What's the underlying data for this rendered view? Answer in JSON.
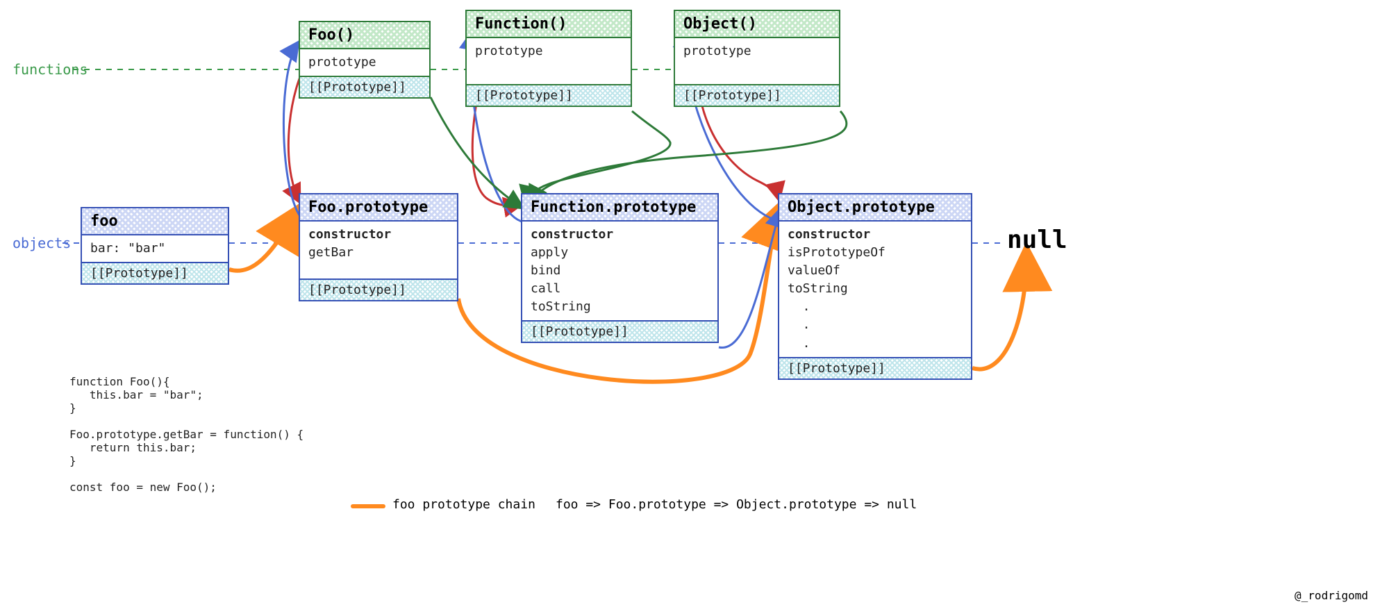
{
  "lanes": {
    "functions": "functions",
    "objects": "objects"
  },
  "null": "null",
  "boxes": {
    "Foo": {
      "title": "Foo()",
      "body": "prototype",
      "slot": "[[Prototype]]"
    },
    "Function": {
      "title": "Function()",
      "body": "prototype",
      "slot": "[[Prototype]]"
    },
    "Object": {
      "title": "Object()",
      "body": "prototype",
      "slot": "[[Prototype]]"
    },
    "foo": {
      "title": "foo",
      "body": "bar: \"bar\"",
      "slot": "[[Prototype]]"
    },
    "FooProto": {
      "title": "Foo.prototype",
      "body_strong": "constructor",
      "body_rest": "getBar",
      "slot": "[[Prototype]]"
    },
    "FunctionProto": {
      "title": "Function.prototype",
      "body_strong": "constructor",
      "body_rest": "apply\nbind\ncall\ntoString",
      "slot": "[[Prototype]]"
    },
    "ObjectProto": {
      "title": "Object.prototype",
      "body_strong": "constructor",
      "body_rest": "isPrototypeOf\nvalueOf\ntoString\n  .\n  .\n  .",
      "slot": "[[Prototype]]"
    }
  },
  "code": "function Foo(){\n   this.bar = \"bar\";\n}\n\nFoo.prototype.getBar = function() {\n   return this.bar;\n}\n\nconst foo = new Foo();",
  "legend": {
    "label": "foo prototype chain",
    "chain": "foo => Foo.prototype => Object.prototype => null"
  },
  "credit": "@_rodrigomd"
}
